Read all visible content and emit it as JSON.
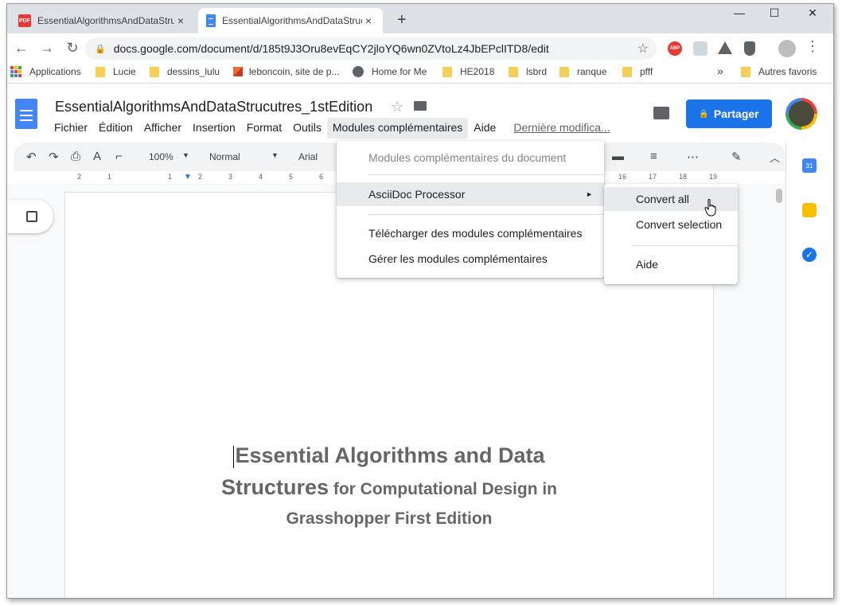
{
  "browser": {
    "tabs": [
      {
        "title": "EssentialAlgorithmsAndDataStruc",
        "favicon": "pdf-icon",
        "favicon_text": "PDF",
        "active": false
      },
      {
        "title": "EssentialAlgorithmsAndDataStruc",
        "favicon": "google-docs-icon",
        "active": true
      }
    ],
    "tab_close": "×",
    "new_tab": "+",
    "window_controls": {
      "minimize": "—",
      "maximize": "☐",
      "close": "✕"
    },
    "nav": {
      "back": "←",
      "forward": "→",
      "reload": "↻"
    },
    "url": "docs.google.com/document/d/185t9J3Oru8evEqCY2jloYQ6wn0ZVtoLz4JbEPclITD8/edit",
    "extensions": [
      {
        "name": "adblock-icon",
        "label": "ABP",
        "color": "#e53935"
      },
      {
        "name": "extension-icon",
        "color": "#9e9e9e"
      },
      {
        "name": "google-drive-icon",
        "color": "#5f6368"
      },
      {
        "name": "shield-icon",
        "color": "#5f6368"
      },
      {
        "name": "profile-icon",
        "color": "#bdbdbd"
      }
    ],
    "menu_dots": "⋮",
    "bookmarks": [
      {
        "label": "Applications",
        "icon": "apps-icon"
      },
      {
        "label": "Lucie",
        "icon": "folder-icon"
      },
      {
        "label": "dessins_lulu",
        "icon": "folder-icon"
      },
      {
        "label": "leboncoin, site de p...",
        "icon": "leboncoin-icon"
      },
      {
        "label": "Home for Me",
        "icon": "globe-icon"
      },
      {
        "label": "HE2018",
        "icon": "folder-icon"
      },
      {
        "label": "lsbrd",
        "icon": "folder-icon"
      },
      {
        "label": "ranque",
        "icon": "folder-icon"
      },
      {
        "label": "pfff",
        "icon": "folder-icon"
      }
    ],
    "bookmarks_overflow": "»",
    "other_bookmarks": "Autres favoris"
  },
  "docs": {
    "title": "EssentialAlgorithmsAndDataStrucutres_1stEdition",
    "menu": [
      "Fichier",
      "Édition",
      "Afficher",
      "Insertion",
      "Format",
      "Outils",
      "Modules complémentaires",
      "Aide"
    ],
    "last_edit": "Dernière modifica...",
    "share_label": "Partager",
    "share_lock": "🔒",
    "toolbar": {
      "zoom": "100%",
      "style": "Normal",
      "font": "Arial"
    },
    "ruler_ticks": [
      "2",
      "1",
      "1",
      "2",
      "3",
      "4",
      "5",
      "6",
      "16",
      "17",
      "18",
      "19"
    ],
    "content": {
      "line1": "Essential Algorithms and Data",
      "line2_big": "Structures",
      "line2_small": " for Computational Design in",
      "line3": "Grasshopper First Edition"
    }
  },
  "addons_menu": {
    "items": [
      {
        "label": "Modules complémentaires du document",
        "disabled": true
      },
      {
        "label": "AsciiDoc Processor",
        "submenu": true,
        "highlighted": true
      },
      {
        "label": "Télécharger des modules complémentaires"
      },
      {
        "label": "Gérer les modules complémentaires"
      }
    ],
    "submenu_arrow": "►"
  },
  "asciidoc_submenu": {
    "items": [
      {
        "label": "Convert all",
        "highlighted": true
      },
      {
        "label": "Convert selection"
      },
      {
        "label": "Aide"
      }
    ]
  },
  "side_panel": {
    "calendar_day": "31"
  },
  "colors": {
    "accent": "#1a73e8",
    "docs_blue": "#4285f4",
    "tab_strip": "#dee1e6",
    "menu_highlight": "#e8eaed"
  }
}
